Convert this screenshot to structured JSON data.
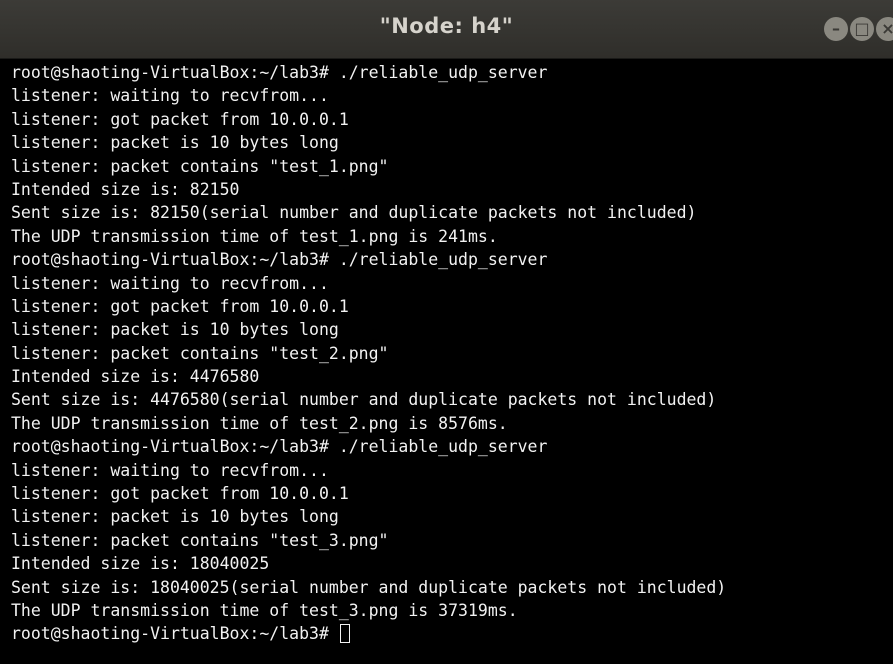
{
  "window": {
    "title": "\"Node: h4\"",
    "buttons": {
      "minimize": "–",
      "maximize": "□",
      "close": "×"
    }
  },
  "terminal": {
    "lines": [
      "root@shaoting-VirtualBox:~/lab3# ./reliable_udp_server",
      "listener: waiting to recvfrom...",
      "listener: got packet from 10.0.0.1",
      "listener: packet is 10 bytes long",
      "listener: packet contains \"test_1.png\"",
      "Intended size is: 82150",
      "Sent size is: 82150(serial number and duplicate packets not included)",
      "The UDP transmission time of test_1.png is 241ms.",
      "root@shaoting-VirtualBox:~/lab3# ./reliable_udp_server",
      "listener: waiting to recvfrom...",
      "listener: got packet from 10.0.0.1",
      "listener: packet is 10 bytes long",
      "listener: packet contains \"test_2.png\"",
      "Intended size is: 4476580",
      "Sent size is: 4476580(serial number and duplicate packets not included)",
      "The UDP transmission time of test_2.png is 8576ms.",
      "root@shaoting-VirtualBox:~/lab3# ./reliable_udp_server",
      "listener: waiting to recvfrom...",
      "listener: got packet from 10.0.0.1",
      "listener: packet is 10 bytes long",
      "listener: packet contains \"test_3.png\"",
      "Intended size is: 18040025",
      "Sent size is: 18040025(serial number and duplicate packets not included)",
      "The UDP transmission time of test_3.png is 37319ms."
    ],
    "prompt": "root@shaoting-VirtualBox:~/lab3# "
  },
  "colors": {
    "titlebar": "#3c3b37",
    "title_text": "#d6d3cc",
    "terminal_bg": "#000000",
    "terminal_fg": "#f2f2f2"
  }
}
